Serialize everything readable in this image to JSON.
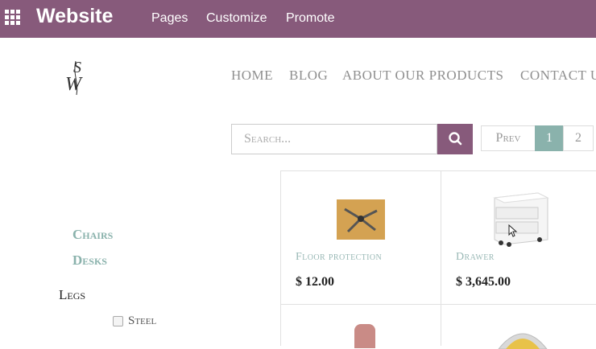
{
  "topbar": {
    "app_title": "Website",
    "menu": [
      "Pages",
      "Customize",
      "Promote"
    ],
    "bg_color": "#875a7b"
  },
  "site": {
    "logo_icon": "sw-monogram-logo",
    "nav": [
      "HOME",
      "BLOG",
      "ABOUT OUR PRODUCTS",
      "CONTACT U"
    ]
  },
  "search": {
    "placeholder": "Search...",
    "button_icon": "search-icon"
  },
  "pager": {
    "prev": "Prev",
    "pages": [
      "1",
      "2"
    ],
    "active": "1"
  },
  "sidebar": {
    "categories": [
      "Chairs",
      "Desks"
    ],
    "attribute": "Legs",
    "options": [
      "Steel"
    ]
  },
  "products": [
    {
      "name": "Floor protection",
      "price": "$ 12.00",
      "image_icon": "floor-protection-image"
    },
    {
      "name": "Drawer",
      "price": "$ 3,645.00",
      "image_icon": "drawer-image"
    }
  ]
}
